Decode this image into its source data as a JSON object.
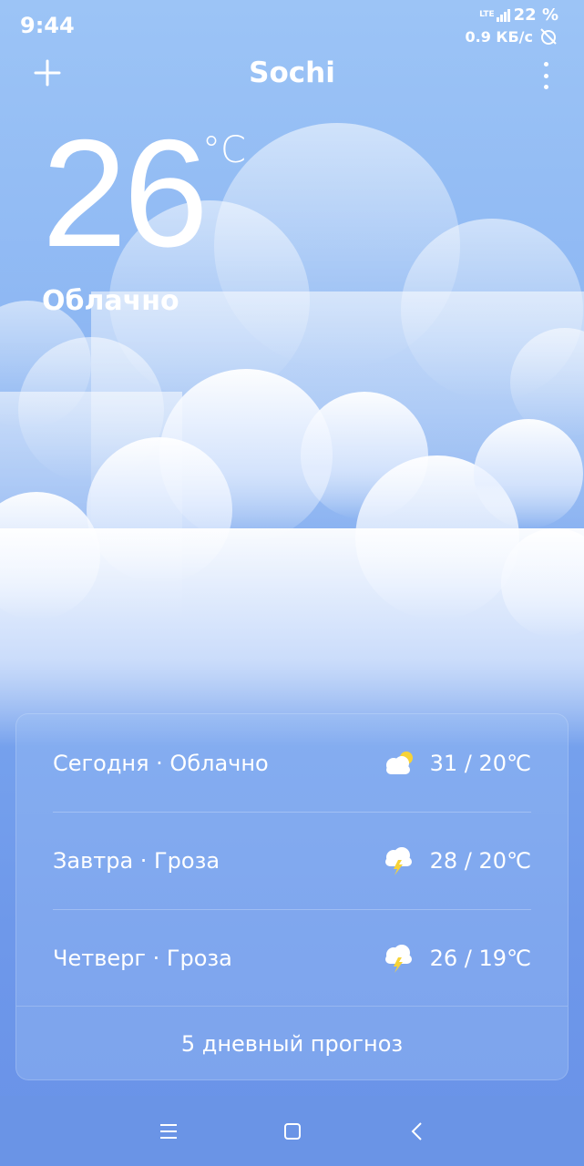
{
  "status_bar": {
    "time": "9:44",
    "network": "LTE",
    "battery": "22 %",
    "speed": "0.9 КБ/с"
  },
  "app_bar": {
    "city": "Sochi",
    "add_icon": "plus-icon",
    "more_icon": "more-vertical-icon"
  },
  "current": {
    "temperature": "26",
    "unit": "°C",
    "condition": "Облачно"
  },
  "forecast": [
    {
      "label": "Сегодня · Облачно",
      "icon": "partly-cloudy-icon",
      "range": "31 / 20℃"
    },
    {
      "label": "Завтра · Гроза",
      "icon": "thunderstorm-icon",
      "range": "28 / 20℃"
    },
    {
      "label": "Четверг · Гроза",
      "icon": "thunderstorm-icon",
      "range": "26 / 19℃"
    }
  ],
  "five_day_label": "5 дневный прогноз",
  "colors": {
    "sky_top": "#9cc4f6",
    "sky_bottom": "#6992e8",
    "sun": "#f7d337"
  }
}
